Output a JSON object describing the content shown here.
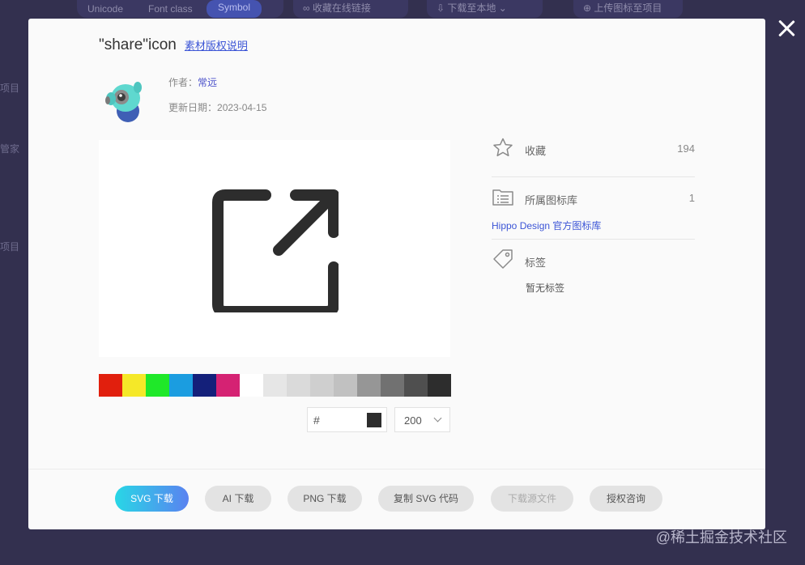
{
  "background": {
    "tabs": [
      "Unicode",
      "Font class",
      "Symbol"
    ],
    "actions": [
      "收藏在线链接",
      "下载至本地",
      "上传图标至项目"
    ],
    "side_items": [
      "项目",
      "管家",
      "项目"
    ]
  },
  "modal": {
    "title": "\"share\"icon",
    "license_link": "素材版权说明",
    "author_label": "作者：",
    "author_name": "常远",
    "updated_label": "更新日期：",
    "updated_date": "2023-04-15",
    "preview": {
      "icon": "share-icon",
      "color": "#2d2d2d"
    },
    "swatches": [
      "#e11f0d",
      "#f5e828",
      "#1fe829",
      "#1b9de0",
      "#14207a",
      "#d52273",
      "#ffffff",
      "#e6e6e6",
      "#dadada",
      "#cfcfcf",
      "#c1c1c1",
      "#969696",
      "#717171",
      "#4f4f4f",
      "#2d2d2d"
    ],
    "hex_prefix": "#",
    "current_color": "#2d2d2d",
    "size": "200",
    "favorites": {
      "label": "收藏",
      "count": "194",
      "icon": "star-icon"
    },
    "library": {
      "label": "所属图标库",
      "count": "1",
      "icon": "library-icon",
      "link": "Hippo Design 官方图标库"
    },
    "tags": {
      "label": "标签",
      "icon": "tag-icon",
      "empty": "暂无标签"
    },
    "buttons": [
      "SVG 下载",
      "AI 下载",
      "PNG 下载",
      "复制 SVG 代码",
      "下载源文件",
      "授权咨询"
    ]
  },
  "watermark": "@稀土掘金技术社区",
  "colors": {
    "overlay": "#33304f",
    "accent": "#3c55d6",
    "gradient_start": "#28d7e6",
    "gradient_end": "#5a82f0"
  }
}
